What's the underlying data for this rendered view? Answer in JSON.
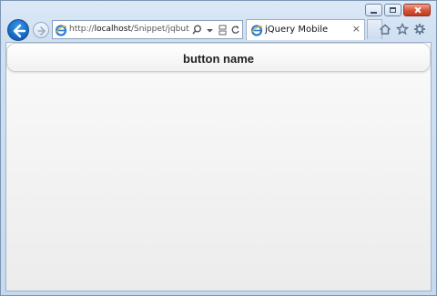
{
  "window": {
    "caption_buttons": [
      "minimize",
      "maximize",
      "close"
    ]
  },
  "navigation": {
    "address_url_host": "http://",
    "address_url_domain": "localhost",
    "address_url_path": "/Snippet/jqbutton.l",
    "search_icon": "magnifier-icon",
    "dropdown_icon": "chevron-down-icon",
    "compat_icon": "compatibility-view-icon",
    "refresh_icon": "refresh-icon"
  },
  "tab": {
    "title": "jQuery Mobile",
    "close_glyph": "×"
  },
  "toolbar_right": [
    "home-icon",
    "favorites-star-icon",
    "tools-gear-icon"
  ],
  "page": {
    "header_title": "button name"
  },
  "colors": {
    "back_button": "#1d74d0",
    "close_button": "#d55236",
    "content_background": "#f2f2f2"
  }
}
